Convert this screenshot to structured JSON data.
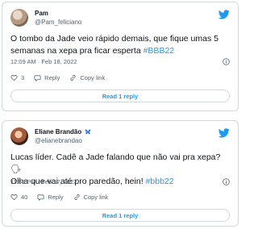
{
  "tweets": [
    {
      "name": "Pam",
      "handle": "@Pam_feliciano",
      "text": "O tombo da Jade veio rápido demais, que fique umas 5 semanas na xepa pra ficar esperta ",
      "hashtag": "#BBB22",
      "timestamp": "12:09 AM · Feb 18, 2022",
      "likes": "3",
      "reply_label": "Reply",
      "copy_link_label": "Copy link",
      "read_replies_label": "Read 1 reply"
    },
    {
      "name": "Eliane Brandão",
      "name_emoji": "🦋",
      "handle": "@elianebrandao",
      "text_line1": "Lucas líder. Cadê a Jade falando que não vai pra xepa? 🗣",
      "text_line2": "Olha que vai até pro paredão, hein! ",
      "hashtag": "#bbb22",
      "timestamp": "11:59 PM · Feb 17, 2022",
      "likes": "40",
      "reply_label": "Reply",
      "copy_link_label": "Copy link",
      "read_replies_label": "Read 1 reply"
    }
  ],
  "colors": {
    "accent": "#1d9bf0",
    "muted": "#536471",
    "border": "#cfd9de"
  }
}
